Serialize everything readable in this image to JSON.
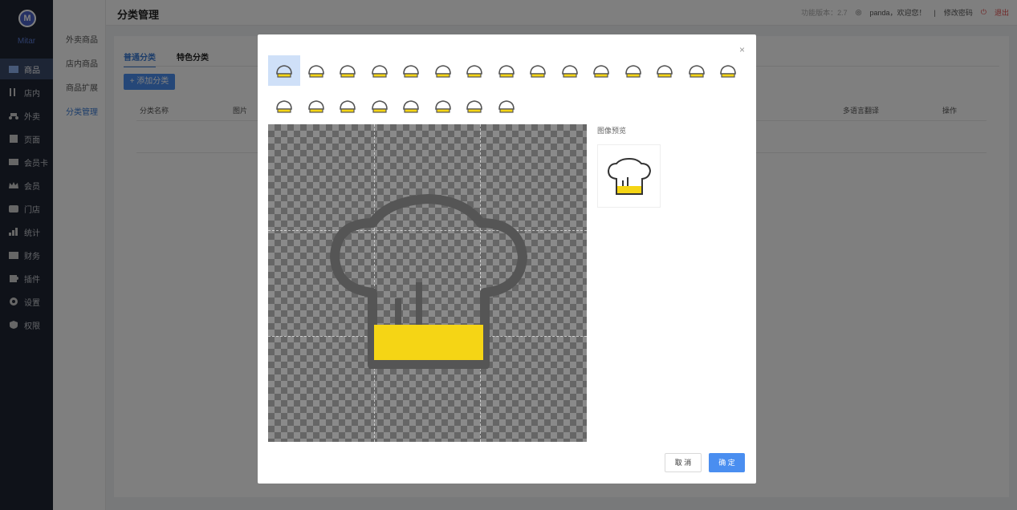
{
  "app": {
    "logo_text": "Mitar"
  },
  "sidebar": {
    "items": [
      {
        "label": "商品",
        "icon": "box-icon"
      },
      {
        "label": "店内",
        "icon": "fork-knife-icon"
      },
      {
        "label": "外卖",
        "icon": "scooter-icon"
      },
      {
        "label": "页面",
        "icon": "page-icon"
      },
      {
        "label": "会员卡",
        "icon": "card-icon"
      },
      {
        "label": "会员",
        "icon": "crown-icon"
      },
      {
        "label": "门店",
        "icon": "store-icon"
      },
      {
        "label": "统计",
        "icon": "chart-icon"
      },
      {
        "label": "财务",
        "icon": "wallet-icon"
      },
      {
        "label": "插件",
        "icon": "puzzle-icon"
      },
      {
        "label": "设置",
        "icon": "gear-icon"
      },
      {
        "label": "权限",
        "icon": "shield-icon"
      }
    ]
  },
  "submenu": {
    "items": [
      "外卖商品",
      "店内商品",
      "商品扩展",
      "分类管理"
    ]
  },
  "header": {
    "title": "分类管理",
    "version": "功能版本：2.7",
    "user": "panda，欢迎您！",
    "change_password": "修改密码",
    "logout": "退出"
  },
  "main": {
    "tabs": [
      "普通分类",
      "特色分类"
    ],
    "add_button": "+ 添加分类",
    "columns": [
      "分类名称",
      "图片",
      "多语言翻译",
      "操作"
    ]
  },
  "modal": {
    "close": "×",
    "preview_label": "图像预览",
    "cancel": "取 消",
    "confirm": "确 定",
    "icons": [
      "chef-hat-icon",
      "cake-slice-icon",
      "shrimp-icon",
      "roast-chicken-icon",
      "utensils-icon",
      "calendar-new-icon",
      "spatula-spoon-icon",
      "coffee-cup-icon",
      "wine-glass-icon",
      "bread-icon",
      "salad-bowl-icon",
      "noodle-bowl-icon",
      "milk-carton-icon",
      "chili-icon",
      "cherry-icon",
      "rice-cooker-icon",
      "pudding-icon",
      "cloche-icon",
      "hot-dish-icon",
      "plate-cutlery-icon",
      "drumstick-icon",
      "cake-icon",
      "ice-cream-icon"
    ]
  },
  "colors": {
    "accent": "#4a8ef0",
    "icon_yellow": "#f5d515",
    "icon_gray": "#555555"
  }
}
